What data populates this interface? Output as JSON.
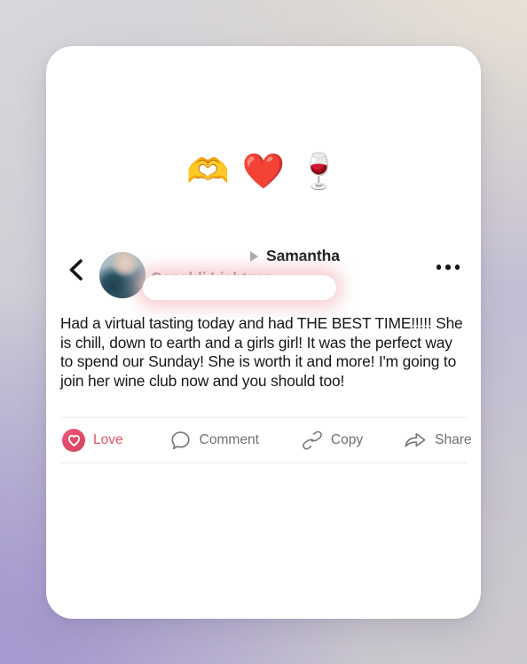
{
  "background": {
    "gradient_colors": [
      "#e9e1d4",
      "#d8d7db",
      "#a498cf",
      "#cdcace"
    ]
  },
  "card": {
    "background_color": "#ffffff",
    "reactions": [
      {
        "name": "heart-hands-emoji",
        "glyph": "🫶"
      },
      {
        "name": "red-heart-emoji",
        "glyph": "❤️"
      },
      {
        "name": "wine-glass-emoji",
        "glyph": "🍷"
      }
    ],
    "header": {
      "back_label": "‹",
      "author_name_primary": "Samantha",
      "author_name_secondary": "Capaldi Lichtner",
      "menu_label": "•••",
      "avatar_alt": "profile-photo"
    },
    "body_text": "Had a virtual tasting today and had THE BEST TIME!!!!! She is chill, down to earth and a girls girl! It was the perfect way to spend our Sunday! She is worth it and more! I'm going to join her wine club now and you should too!",
    "actions": [
      {
        "name": "love",
        "label": "Love",
        "icon": "heart-filled-circle-icon",
        "active": true,
        "color": "#e0526a"
      },
      {
        "name": "comment",
        "label": "Comment",
        "icon": "speech-bubble-icon",
        "active": false,
        "color": "#6e7076"
      },
      {
        "name": "copy",
        "label": "Copy",
        "icon": "link-chain-icon",
        "active": false,
        "color": "#6e7076"
      },
      {
        "name": "share",
        "label": "Share",
        "icon": "share-arrow-icon",
        "active": false,
        "color": "#6e7076"
      }
    ]
  }
}
